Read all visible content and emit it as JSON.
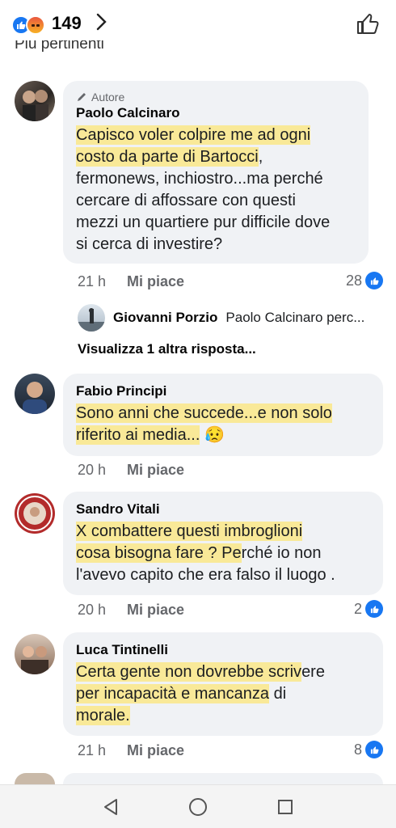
{
  "header": {
    "reaction_count": "149",
    "section_label": "Più pertinenti"
  },
  "comments": [
    {
      "author_tag": "Autore",
      "name": "Paolo Calcinaro",
      "text_hl1": "Capisco voler colpire me ad ogni",
      "text_hl2": "costo da parte di Bartocci",
      "text_rest1": ",",
      "text_line3": "fermonews, inchiostro...ma perché",
      "text_line4": "cercare di affossare con questi",
      "text_line5": "mezzi un quartiere pur difficile dove",
      "text_line6": "si cerca di investire?",
      "time": "21 h",
      "like_label": "Mi piace",
      "reaction_count": "28"
    },
    {
      "name": "Fabio Principi",
      "text_hl1": "Sono anni che succede...e non solo",
      "text_hl2": "riferito ai media...",
      "emoji": "😥",
      "time": "20 h",
      "like_label": "Mi piace"
    },
    {
      "name": "Sandro Vitali",
      "text_hl1": "X combattere questi imbroglioni",
      "text_hl2": "cosa bisogna fare ? Pe",
      "text_rest2": "rché io non",
      "text_line3": "l'avevo capito che era falso il luogo .",
      "time": "20 h",
      "like_label": "Mi piace",
      "reaction_count": "2"
    },
    {
      "name": "Luca Tintinelli",
      "text_hl1": "Certa gente non dovrebbe scriv",
      "text_rest1": "ere",
      "text_hl2a": "per incapacità e mancanza",
      "text_rest2": " di",
      "text_hl3": "morale.",
      "time": "21 h",
      "like_label": "Mi piace",
      "reaction_count": "8"
    }
  ],
  "reply": {
    "name": "Giovanni Porzio",
    "text": "Paolo Calcinaro perc..."
  },
  "more_replies_label": "Visualizza 1 altra risposta...",
  "colors": {
    "facebook_blue": "#1877f2",
    "bubble_bg": "#f0f2f5",
    "highlight": "#ffe25a"
  }
}
